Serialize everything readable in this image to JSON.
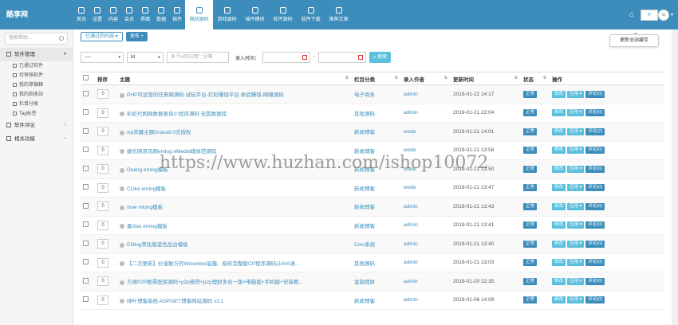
{
  "app": {
    "logo": "酷享网"
  },
  "nav": [
    {
      "label": "首页",
      "icon": "home-icon"
    },
    {
      "label": "设置",
      "icon": "gear-icon"
    },
    {
      "label": "内容",
      "icon": "document-icon"
    },
    {
      "label": "会员",
      "icon": "user-icon"
    },
    {
      "label": "界面",
      "icon": "monitor-icon"
    },
    {
      "label": "数据",
      "icon": "database-icon"
    },
    {
      "label": "插件",
      "icon": "plugin-icon"
    },
    {
      "label": "网站源码",
      "icon": "grid-icon",
      "active": true
    },
    {
      "label": "游戏源码",
      "icon": "grid-icon"
    },
    {
      "label": "插件模块",
      "icon": "grid-icon"
    },
    {
      "label": "软件源码",
      "icon": "grid-icon"
    },
    {
      "label": "软件下载",
      "icon": "grid-icon"
    },
    {
      "label": "推荐文章",
      "icon": "grid-icon"
    }
  ],
  "topright": {
    "tooltip": "更新全站缓存"
  },
  "sidebar": {
    "search_placeholder": "搜索帮助...",
    "groups": [
      {
        "label": "软件管理",
        "open": true,
        "items": [
          "已通过软件",
          "待审核软件",
          "我的草稿箱",
          "我的回收站",
          "栏目分类",
          "Tag标签"
        ]
      },
      {
        "label": "软件评论"
      },
      {
        "label": "相关功能"
      }
    ]
  },
  "toolbar": {
    "passed_label": "已通过的内容 ▾",
    "publish_label": "发布 +"
  },
  "filters": {
    "select1": "----",
    "select2": "Id",
    "ids_placeholder": "多个id可以用“,”分隔",
    "time_label": "录入时间：",
    "dash": "-",
    "search_label": "搜索"
  },
  "table": {
    "headers": [
      "",
      "排序",
      "主题",
      "栏目分类",
      "录入作者",
      "更新时间",
      "状态",
      "操作"
    ],
    "actions": {
      "edit": "修改",
      "app": "应用 ▾"
    },
    "status_label": "正常",
    "rows": [
      {
        "sort": "0",
        "title": "PHP可运营的任务网源码 试玩平台-打码赚钱平台 体验赚钱-网赚源码",
        "category": "电子商务",
        "author": "admin",
        "time": "2019-01-22 14:17",
        "comment": "评论(0)"
      },
      {
        "sort": "0",
        "title": "彩虹代刷网数据查询小程序源码 无需数据库",
        "category": "其他源码",
        "author": "admin",
        "time": "2019-01-21 22:04",
        "comment": "评论(0)"
      },
      {
        "sort": "0",
        "title": "wp苏醒主题Grace8.0去授权",
        "category": "新闻博客",
        "author": "wode",
        "time": "2019-01-21 14:01",
        "comment": "评论(2)"
      },
      {
        "sort": "0",
        "title": "娱乐网资讯网emlog eMedia媒体范源码",
        "category": "新闻博客",
        "author": "wode",
        "time": "2019-01-21 13:58",
        "comment": "评论(0)"
      },
      {
        "sort": "0",
        "title": "Duang emlog模板",
        "category": "新闻博客",
        "author": "wode",
        "time": "2019-01-21 13:50",
        "comment": "评论(0)"
      },
      {
        "sort": "0",
        "title": "COke emlog模板",
        "category": "新闻博客",
        "author": "wode",
        "time": "2019-01-21 13:47",
        "comment": "评论(0)"
      },
      {
        "sort": "0",
        "title": "moe mlong模板",
        "category": "新闻博客",
        "author": "admin",
        "time": "2019-01-21 13:43",
        "comment": "评论(0)"
      },
      {
        "sort": "0",
        "title": "墨Jiao emlog模板",
        "category": "新闻博客",
        "author": "admin",
        "time": "2019-01-21 13:41",
        "comment": "评论(0)"
      },
      {
        "sort": "0",
        "title": "EMlog美化版蓝色后台模板",
        "category": "Cms系统",
        "author": "admin",
        "time": "2019-01-21 13:40",
        "comment": "评论(0)"
      },
      {
        "sort": "0",
        "title": "【二次更新】价值数万的Winonline底蕴、极彩完整版CP程序源码(JAVA语...",
        "category": "其他源码",
        "author": "admin",
        "time": "2019-01-21 13:03",
        "comment": "评论(0)"
      },
      {
        "sort": "0",
        "title": "方维P2P股票配资源码+p2p借贷+p2p理财多合一版+电脑版+手机版+安装教...",
        "category": "金融理财",
        "author": "admin",
        "time": "2019-01-20 22:35",
        "comment": "评论(0)"
      },
      {
        "sort": "0",
        "title": "绿叶博客系统-ASP.NET博客网站源码 v3.1",
        "category": "新闻博客",
        "author": "admin",
        "time": "2019-01-06 14:09",
        "comment": "评论(0)"
      }
    ]
  },
  "watermark": "https://www.huzhan.com/ishop10072"
}
